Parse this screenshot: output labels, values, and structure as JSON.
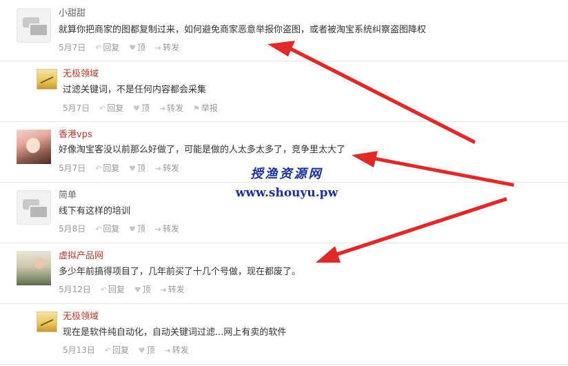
{
  "comments": [
    {
      "user": "小甜甜",
      "text": "就算你把商家的图都复制过来，如何避免商家恶意举报你盗图，或者被淘宝系统纠察盗图降权",
      "date": "5月7日",
      "reply": "回复",
      "top": "顶",
      "forward": "转发",
      "avatar_icon": "default-avatar-icon"
    },
    {
      "user": "无极领域",
      "text": "过滤关键词，不是任何内容都会采集",
      "date": "5月7日",
      "reply": "回复",
      "top": "顶",
      "forward": "转发",
      "report": "举报",
      "avatar_icon": "landscape-avatar"
    },
    {
      "user": "香港vps",
      "text": "好像淘宝客没以前那么好做了，可能是做的人太多太多了，竞争里太大了",
      "date": "5月7日",
      "reply": "回复",
      "top": "顶",
      "forward": "转发",
      "avatar_icon": "girl-photo-avatar"
    },
    {
      "user": "简单",
      "text": "线下有这样的培训",
      "date": "5月8日",
      "reply": "回复",
      "top": "顶",
      "forward": "转发",
      "avatar_icon": "default-avatar-icon"
    },
    {
      "user": "虚拟产品网",
      "text": "多少年前搞得项目了，几年前买了十几个号做，现在都废了。",
      "date": "5月12日",
      "reply": "回复",
      "top": "顶",
      "forward": "转发",
      "avatar_icon": "photo-avatar"
    },
    {
      "user": "无极领域",
      "text": "现在是软件纯自动化，自动关键词过滤...网上有卖的软件",
      "date": "5月13日",
      "reply": "回复",
      "top": "顶",
      "forward": "转发",
      "avatar_icon": "landscape-avatar"
    }
  ],
  "watermark": {
    "line1": "授渔资源网",
    "line2": "www.shouyu.pw"
  },
  "colors": {
    "link_name": "#c0392b",
    "plain_name": "#666666",
    "meta": "#999999",
    "arrow": "#e02a2a",
    "watermark": "#1a2fa0"
  }
}
